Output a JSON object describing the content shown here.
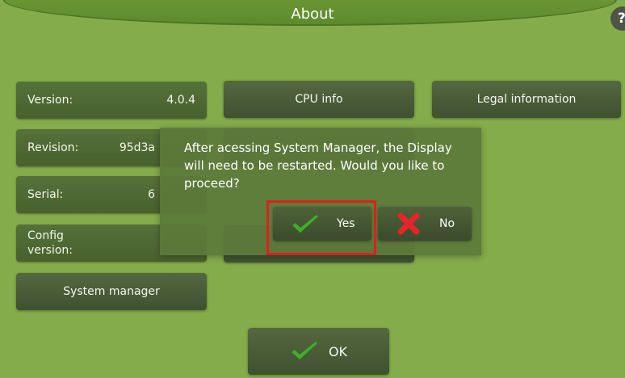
{
  "header": {
    "title": "About",
    "help_icon": "question-mark-icon",
    "help_glyph": "?"
  },
  "info": {
    "version": {
      "label": "Version:",
      "value": "4.0.4"
    },
    "revision": {
      "label": "Revision:",
      "value": "95d3a"
    },
    "serial": {
      "label": "Serial:",
      "value": "6"
    },
    "config": {
      "label": "Config\nversion:",
      "value": ""
    }
  },
  "buttons": {
    "cpu_info": "CPU info",
    "legal_information": "Legal information",
    "system_manager": "System manager",
    "ok": "OK"
  },
  "dialog": {
    "message": "After acessing System Manager, the Display will need to be restarted. Would you like to proceed?",
    "yes_label": "Yes",
    "no_label": "No"
  },
  "colors": {
    "background": "#84ac4a",
    "panel": "#4f6a34",
    "check_green": "#3fae2a",
    "x_red": "#e8242b",
    "highlight_red": "#e01e1e"
  }
}
